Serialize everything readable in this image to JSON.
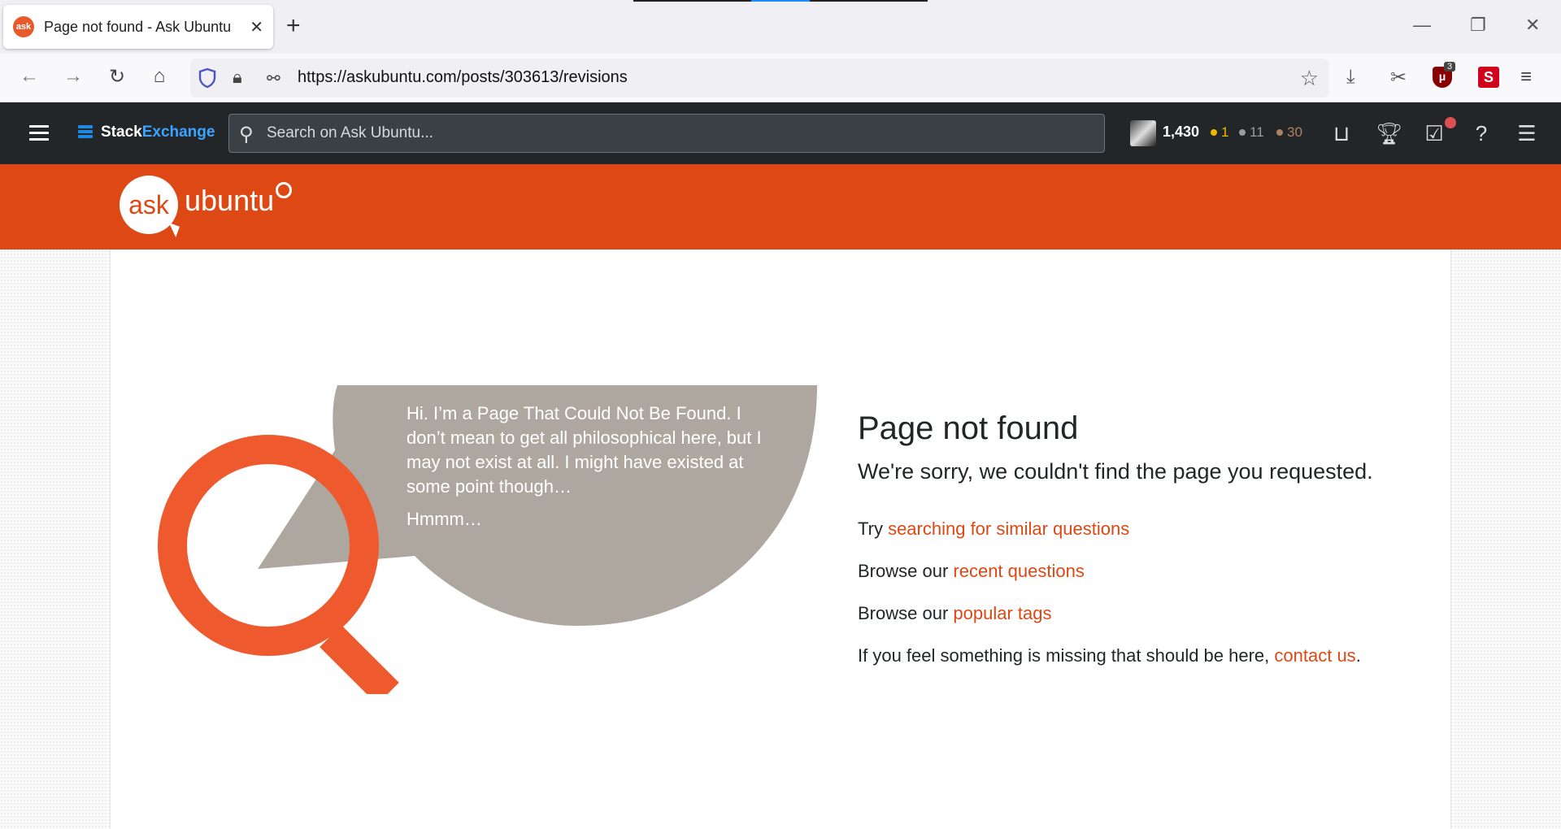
{
  "browser": {
    "tab_title": "Page not found - Ask Ubuntu",
    "tab_favicon": "ask",
    "url": "https://askubuntu.com/posts/303613/revisions",
    "ublock_count": "3",
    "extension_label": "S"
  },
  "se_bar": {
    "logo_part1": "Stack",
    "logo_part2": "Exchange",
    "search_placeholder": "Search on Ask Ubuntu...",
    "reputation": "1,430",
    "gold_badges": "1",
    "silver_badges": "11",
    "bronze_badges": "30",
    "colors": {
      "gold": "#f1b600",
      "silver": "#9a9c9e",
      "bronze": "#ab825f"
    }
  },
  "site": {
    "logo_ask": "ask",
    "logo_ubuntu": "ubuntu",
    "brand_color": "#dd4814"
  },
  "speech": {
    "line1": "Hi. I’m a Page That Could Not Be Found. I don’t mean to get all philosophical here, but I may not exist at all. I might have existed at some point though…",
    "line2": "Hmmm…"
  },
  "not_found": {
    "title": "Page not found",
    "subtitle": "We're sorry, we couldn't find the page you requested.",
    "try_prefix": "Try ",
    "try_link": "searching for similar questions",
    "browse_prefix1": "Browse our ",
    "browse_link1": "recent questions",
    "browse_prefix2": "Browse our ",
    "browse_link2": "popular tags",
    "missing_prefix": "If you feel something is missing that should be here, ",
    "missing_link": "contact us",
    "missing_suffix": "."
  }
}
